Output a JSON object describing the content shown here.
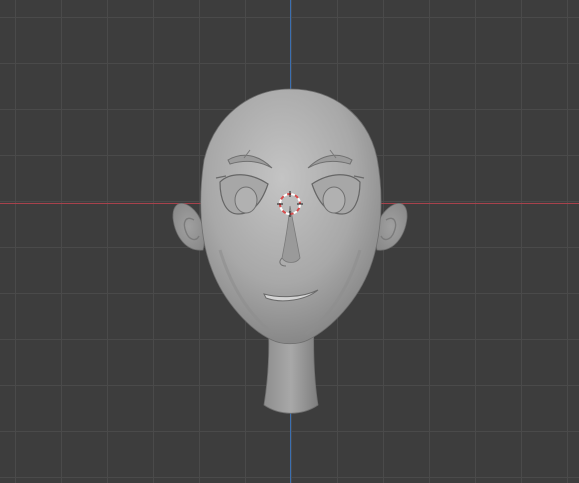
{
  "viewport": {
    "background_color": "#3d3d3d",
    "grid_line_color": "#4a4a4a",
    "x_axis_color": "#a8424c",
    "y_axis_color": "#3b6fb0"
  },
  "model": {
    "object": "stylized-head-sculpt",
    "shading": "solid-gray",
    "base_color": "#a9a9a9"
  },
  "cursor": {
    "icon": "3d-cursor-icon",
    "colors": [
      "#d84a4a",
      "#ffffff"
    ]
  }
}
